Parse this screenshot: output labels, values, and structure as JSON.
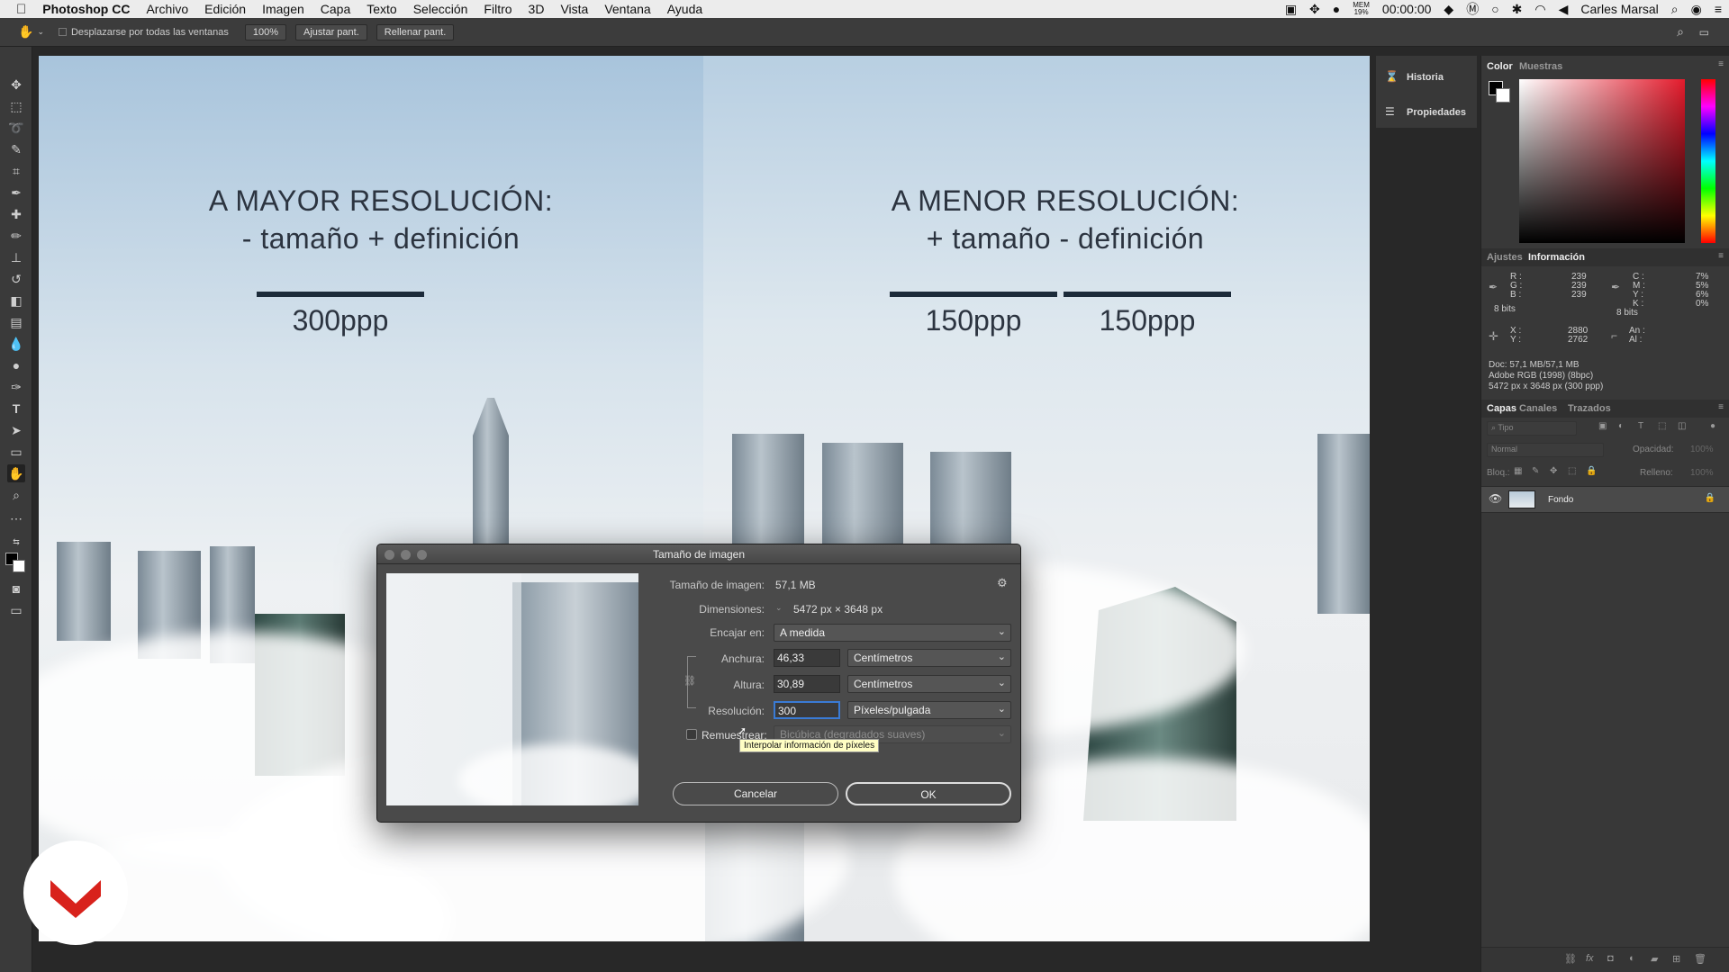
{
  "menubar": {
    "apple": "",
    "app_name": "Photoshop CC",
    "items": [
      "Archivo",
      "Edición",
      "Imagen",
      "Capa",
      "Texto",
      "Selección",
      "Filtro",
      "3D",
      "Vista",
      "Ventana",
      "Ayuda"
    ],
    "mem_label": "MEM",
    "mem_value": "19%",
    "clock": "00:00:00",
    "user": "Carles Marsal"
  },
  "optbar": {
    "scroll_all": "Desplazarse por todas las ventanas",
    "zoom": "100%",
    "fit": "Ajustar pant.",
    "fill": "Rellenar pant."
  },
  "canvas": {
    "left_title_1": "A MAYOR RESOLUCIÓN:",
    "left_title_2": "- tamaño + definición",
    "left_ppp": "300ppp",
    "right_title_1": "A MENOR RESOLUCIÓN:",
    "right_title_2": "+ tamaño - definición",
    "right_ppp_1": "150ppp",
    "right_ppp_2": "150ppp"
  },
  "dialog": {
    "title": "Tamaño de imagen",
    "size_label": "Tamaño de imagen:",
    "size_value": "57,1 MB",
    "dim_label": "Dimensiones:",
    "dim_value": "5472 px × 3648 px",
    "fit_label": "Encajar en:",
    "fit_value": "A medida",
    "width_label": "Anchura:",
    "width_value": "46,33",
    "width_unit": "Centímetros",
    "height_label": "Altura:",
    "height_value": "30,89",
    "height_unit": "Centímetros",
    "res_label": "Resolución:",
    "res_value": "300",
    "res_unit": "Píxeles/pulgada",
    "resample_label": "Remuestrear:",
    "resample_value": "Bicúbica (degradados suaves)",
    "tooltip": "Interpolar información de píxeles",
    "cancel": "Cancelar",
    "ok": "OK"
  },
  "midpanel": {
    "historia": "Historia",
    "propiedades": "Propiedades"
  },
  "rightpanel": {
    "color_tab": "Color",
    "muestras_tab": "Muestras",
    "ajustes_tab": "Ajustes",
    "info_tab": "Información",
    "r_label": "R :",
    "r_val": "239",
    "g_label": "G :",
    "g_val": "239",
    "b_label": "B :",
    "b_val": "239",
    "bits1": "8 bits",
    "c_label": "C :",
    "c_val": "7%",
    "m_label": "M :",
    "m_val": "5%",
    "y_label": "Y :",
    "y_val": "6%",
    "k_label": "K :",
    "k_val": "0%",
    "bits2": "8 bits",
    "x_label": "X :",
    "x_val": "2880",
    "yy_label": "Y :",
    "yy_val": "2762",
    "an_label": "An :",
    "al_label": "Al :",
    "doc_line": "Doc: 57,1 MB/57,1 MB",
    "profile": "Adobe RGB (1998) (8bpc)",
    "px_line": "5472 px x 3648 px (300 ppp)",
    "capas_tab": "Capas",
    "canales_tab": "Canales",
    "trazados_tab": "Trazados",
    "search_placeholder": "Tipo",
    "blend_mode": "Normal",
    "opacity_label": "Opacidad:",
    "opacity_value": "100%",
    "lock_label": "Bloq.:",
    "fill_label": "Relleno:",
    "fill_value": "100%",
    "layer_name": "Fondo"
  },
  "colors": {
    "menubar_bg": "#ececec",
    "panel_bg": "#383838",
    "headline": "#2c3440",
    "rule": "#1c2b3a",
    "logo_red": "#d8221c"
  }
}
